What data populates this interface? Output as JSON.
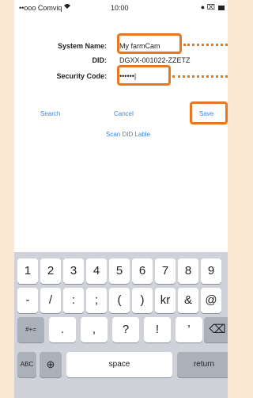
{
  "status": {
    "carrier": "••ooo Comviq",
    "wifi": "wifi-icon",
    "time": "10:00",
    "indicators": "● ⌧"
  },
  "form": {
    "system_name_label": "System Name:",
    "system_name_value": "My farmCam",
    "did_label": "DID:",
    "did_value": "DGXX-001022-ZZETZ",
    "security_code_label": "Security Code:",
    "security_code_value": "••••••|"
  },
  "actions": {
    "search": "Search",
    "cancel": "Cancel",
    "save": "Save",
    "scan": "Scan DID Lable"
  },
  "keyboard": {
    "row1": [
      "1",
      "2",
      "3",
      "4",
      "5",
      "6",
      "7",
      "8",
      "9"
    ],
    "row2": [
      "-",
      "/",
      ":",
      ";",
      "(",
      ")",
      "kr",
      "&",
      "@"
    ],
    "row3_left": "#+=",
    "row3": [
      ".",
      ",",
      "?",
      "!",
      "'"
    ],
    "row4_abc": "ABC",
    "row4_space": "space",
    "row4_return": "return"
  },
  "colors": {
    "highlight": "#e87722",
    "link": "#3e86d6",
    "background": "#fbe8d3"
  }
}
